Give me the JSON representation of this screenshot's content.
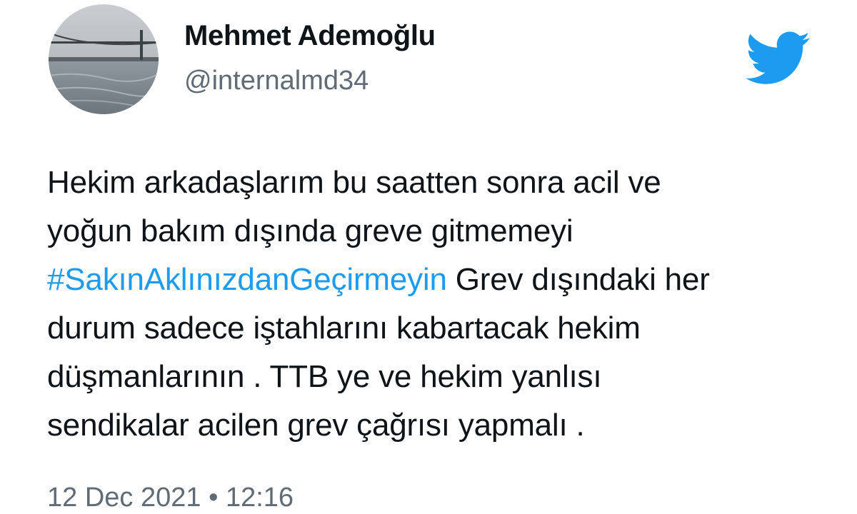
{
  "author": {
    "display_name": "Mehmet Ademoğlu",
    "handle": "@internalmd34"
  },
  "icons": {
    "avatar": "profile-photo-bridge",
    "brand": "twitter-bird-icon",
    "brand_color": "#1d9bf0"
  },
  "tweet": {
    "lines": [
      "Hekim arkadaşlarım bu saatten sonra acil ve",
      "yoğun bakım dışında greve gitmemeyi"
    ],
    "hashtag": "#SakınAklınızdanGeçirmeyin",
    "line3_rest": " Grev dışındaki her",
    "lines_after": [
      "durum sadece iştahlarını kabartacak hekim",
      "düşmanlarının . TTB ye ve hekim yanlısı",
      "sendikalar acilen grev çağrısı yapmalı ."
    ]
  },
  "meta": {
    "date": "12 Dec 2021",
    "separator": "•",
    "time": "12:16"
  }
}
